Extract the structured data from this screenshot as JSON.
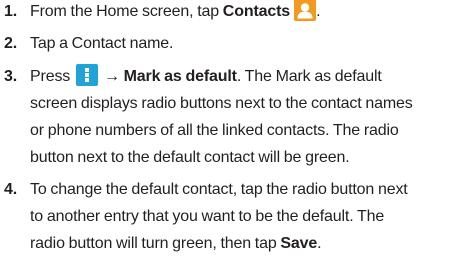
{
  "steps": [
    {
      "number": "1.",
      "text_before": "From the Home screen, tap ",
      "bold": "Contacts",
      "text_after": ".",
      "icon": "contacts-app-icon"
    },
    {
      "number": "2.",
      "text": "Tap a Contact name."
    },
    {
      "number": "3.",
      "text_before": "Press",
      "icon": "menu-icon",
      "arrow": "→",
      "bold": "Mark as default",
      "line1_after": ". The Mark as default",
      "line2": "screen displays radio buttons next to the contact names",
      "line3": "or phone numbers of all the linked contacts. The radio",
      "line4": "button next to the default contact will be green."
    },
    {
      "number": "4.",
      "line1": "To change the default contact, tap the radio button next",
      "line2": "to another entry that you want to be the default. The",
      "line3_before": "radio button will turn green, then tap ",
      "bold": "Save",
      "line3_after": "."
    }
  ],
  "colors": {
    "contacts_icon": "#f39a1e",
    "menu_icon": "#20a4d8",
    "text": "#231f20"
  }
}
